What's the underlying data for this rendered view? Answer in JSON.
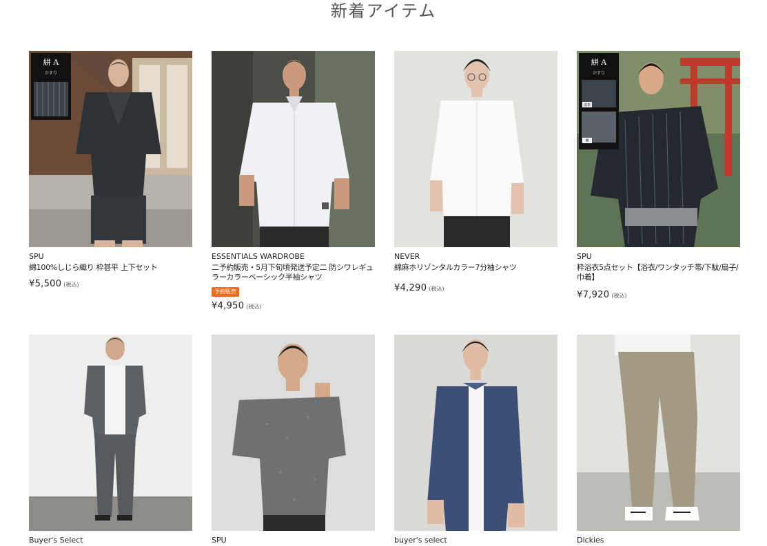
{
  "section_title": "新着アイテム",
  "products": [
    {
      "brand": "SPU",
      "name": "綿100%しじら織り 枠甚平 上下セット",
      "badge": "",
      "price": "¥5,500",
      "tax": "(税込)",
      "image_icon": "jinbei-photo",
      "swatch_title": "絣 A",
      "swatch_sub": "かすり"
    },
    {
      "brand": "ESSENTIALS WARDROBE",
      "name": "二予約販売・5月下旬頃発送予定二 防シワレギュラーカラーベーシック半袖シャツ",
      "badge": "予約販売",
      "price": "¥4,950",
      "tax": "(税込)",
      "image_icon": "white-shirt-photo"
    },
    {
      "brand": "NEVER",
      "name": "綿麻ホリゾンタルカラー7分袖シャツ",
      "badge": "",
      "price": "¥4,290",
      "tax": "(税込)",
      "image_icon": "white-shirt-photo"
    },
    {
      "brand": "SPU",
      "name": "粋浴衣5点セット【浴衣/ワンタッチ帯/下駄/扇子/巾着】",
      "badge": "",
      "price": "¥7,920",
      "tax": "(税込)",
      "image_icon": "yukata-photo",
      "swatch_title": "絣 A",
      "swatch_sub": "かすり",
      "swatch_label_1": "浴衣",
      "swatch_label_2": "帯"
    },
    {
      "brand": "Buyer's Select",
      "image_icon": "setup-photo"
    },
    {
      "brand": "SPU",
      "image_icon": "knit-tee-photo"
    },
    {
      "brand": "buyer's select",
      "image_icon": "denim-shirt-photo"
    },
    {
      "brand": "Dickies",
      "image_icon": "chino-pants-photo"
    }
  ]
}
